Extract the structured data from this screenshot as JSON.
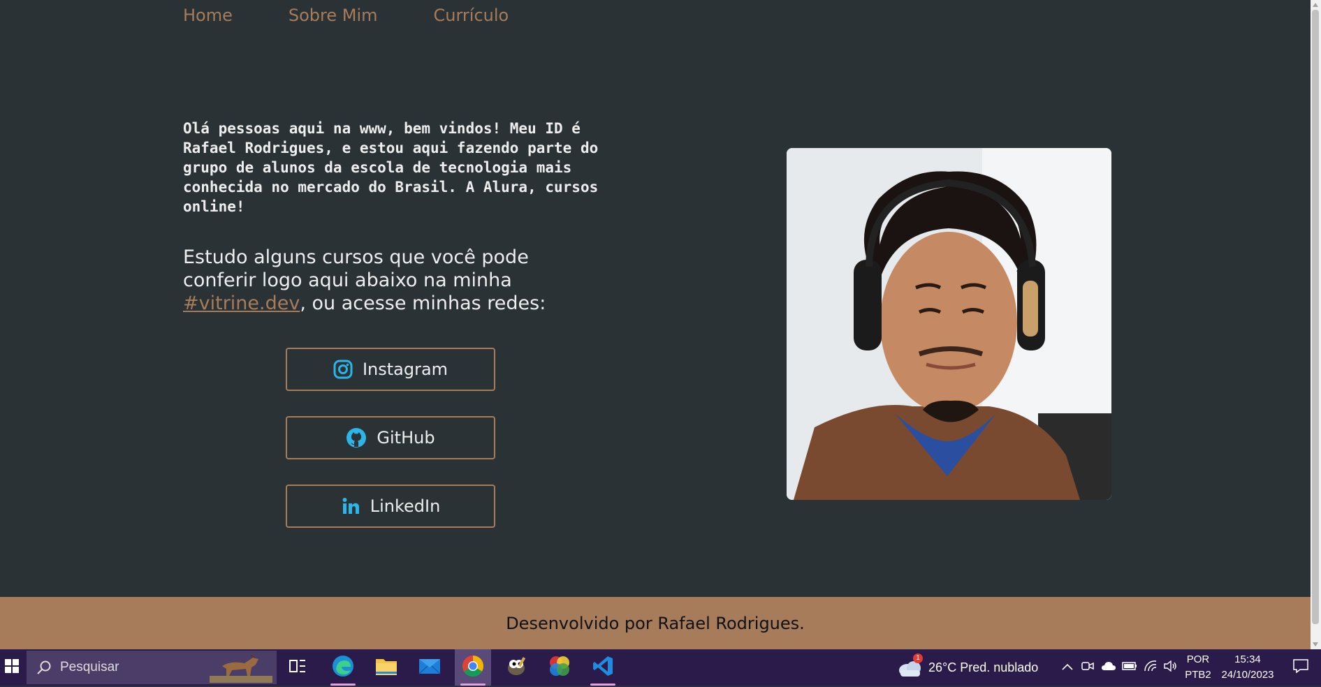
{
  "nav": {
    "home": "Home",
    "about": "Sobre Mim",
    "resume": "Currículo"
  },
  "intro": "Olá pessoas aqui na www, bem vindos! Meu ID é Rafael Rodrigues, e estou aqui fazendo parte do grupo de alunos da escola de tecnologia mais conhecida no mercado do Brasil. A Alura, cursos online!",
  "courses": {
    "before": "Estudo alguns cursos que você pode conferir logo aqui abaixo na minha ",
    "link": "#vitrine.dev",
    "after": ", ou acesse minhas redes:"
  },
  "buttons": {
    "instagram": "Instagram",
    "github": "GitHub",
    "linkedin": "LinkedIn"
  },
  "footer": "Desenvolvido por Rafael Rodrigues.",
  "taskbar": {
    "search_placeholder": "Pesquisar",
    "weather": "26°C  Pred. nublado",
    "weather_badge": "1",
    "lang_line1": "POR",
    "lang_line2": "PTB2",
    "time": "15:34",
    "date": "24/10/2023"
  },
  "colors": {
    "background": "#2a3235",
    "accent": "#a67c5b",
    "text": "#eeeeee",
    "icon": "#2bb5e8",
    "taskbar": "#2a1b4b"
  }
}
